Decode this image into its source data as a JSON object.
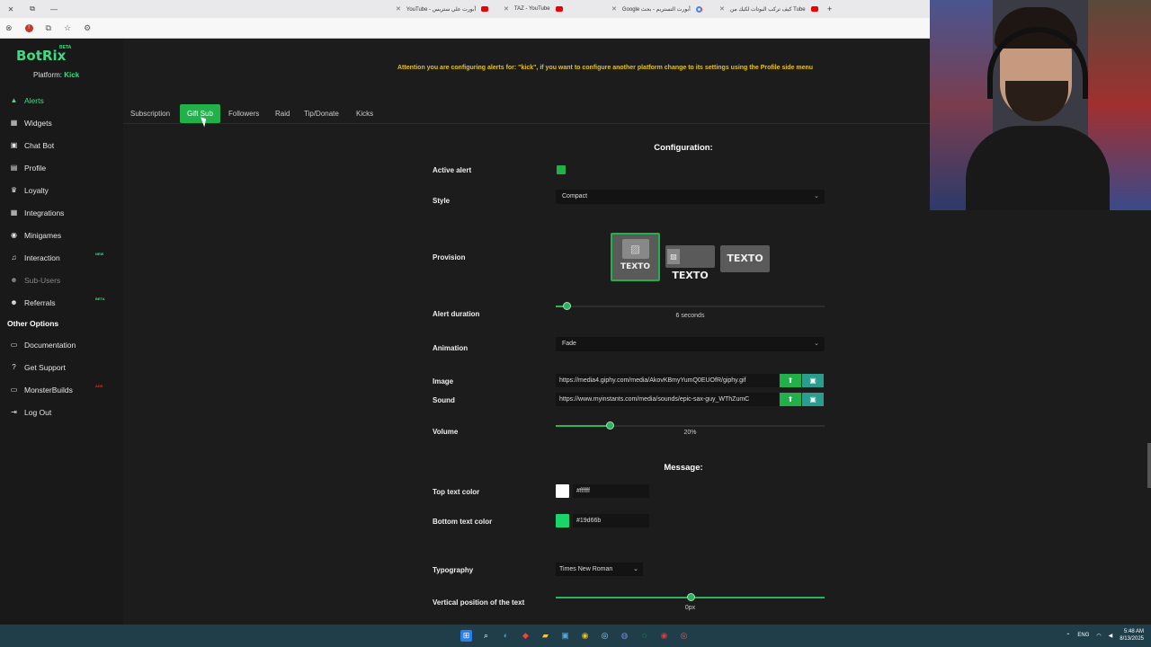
{
  "browser": {
    "tabs": [
      {
        "title": "كيف تركب البوتات لكيك من Tube",
        "icon": "youtube-icon"
      },
      {
        "title": "Google أبورت التستريم - بحث",
        "icon": "google-icon"
      },
      {
        "title": "TAZ - YouTube",
        "icon": "youtube-icon"
      },
      {
        "title": "YouTube - أبورت علي ستريس",
        "icon": "youtube-icon"
      }
    ],
    "new_tab": "+",
    "win_min": "—",
    "win_restore": "⧉",
    "win_close": "✕"
  },
  "app": {
    "logo": "BotRix",
    "logo_badge": "BETA",
    "platform_label": "Platform:",
    "platform_value": "Kick",
    "notice": "Attention you are configuring alerts for: \"kick\", if you want to configure another platform change to its settings using the Profile side menu",
    "nav": [
      {
        "label": "Alerts",
        "icon": "warning-icon",
        "glyph": "▲",
        "active": true
      },
      {
        "label": "Widgets",
        "icon": "grid-icon",
        "glyph": "▦"
      },
      {
        "label": "Chat Bot",
        "icon": "chat-icon",
        "glyph": "▣"
      },
      {
        "label": "Profile",
        "icon": "id-card-icon",
        "glyph": "▤"
      },
      {
        "label": "Loyalty",
        "icon": "trophy-icon",
        "glyph": "♛"
      },
      {
        "label": "Integrations",
        "icon": "table-icon",
        "glyph": "▦"
      },
      {
        "label": "Minigames",
        "icon": "gamepad-icon",
        "glyph": "◉"
      },
      {
        "label": "Interaction",
        "icon": "music-icon",
        "glyph": "♫",
        "badge": "NEW"
      },
      {
        "label": "Sub-Users",
        "icon": "users-icon",
        "glyph": "☻",
        "dim": true
      },
      {
        "label": "Referrals",
        "icon": "people-icon",
        "glyph": "☻",
        "badge": "BETA"
      }
    ],
    "other_section": "Other Options",
    "other_nav": [
      {
        "label": "Documentation",
        "icon": "book-icon",
        "glyph": "▭"
      },
      {
        "label": "Get Support",
        "icon": "question-icon",
        "glyph": "?"
      },
      {
        "label": "MonsterBuilds",
        "icon": "monitor-icon",
        "glyph": "▭",
        "badge": "ADS",
        "badge_red": true
      },
      {
        "label": "Log Out",
        "icon": "logout-icon",
        "glyph": "⇥"
      }
    ],
    "alert_tabs": [
      "Subscription",
      "Gift Sub",
      "Followers",
      "Raid",
      "Tip/Donate",
      "Kicks"
    ],
    "active_tab": 1,
    "config": {
      "heading": "Configuration:",
      "active_alert_label": "Active alert",
      "style_label": "Style",
      "style_value": "Compact",
      "provision_label": "Provision",
      "provision_text": "TEXTO",
      "duration_label": "Alert duration",
      "duration_value": "6 seconds",
      "duration_fraction": 0.04,
      "animation_label": "Animation",
      "animation_value": "Fade",
      "image_label": "Image",
      "image_url": "https://media4.giphy.com/media/AkovKBmyYumQ0EUOfR/giphy.gif",
      "sound_label": "Sound",
      "sound_url": "https://www.myinstants.com/media/sounds/epic-sax-guy_WThZumC",
      "volume_label": "Volume",
      "volume_value": "20%",
      "volume_fraction": 0.2
    },
    "message": {
      "heading": "Message:",
      "top_color_label": "Top text color",
      "top_color": "#ffffff",
      "top_color_text": "#ffffff",
      "bottom_color_label": "Bottom text color",
      "bottom_color": "#19d66b",
      "bottom_color_text": "#19d66b",
      "typography_label": "Typography",
      "typography_value": "Times New Roman",
      "vertical_label": "Vertical position of the text",
      "vertical_value": "0px",
      "vertical_fraction": 0.5
    }
  },
  "taskbar": {
    "lang": "ENG",
    "time": "5:48 AM",
    "date": "8/13/2025"
  },
  "colors": {
    "accent": "#22b04b",
    "notice": "#e9c400"
  }
}
